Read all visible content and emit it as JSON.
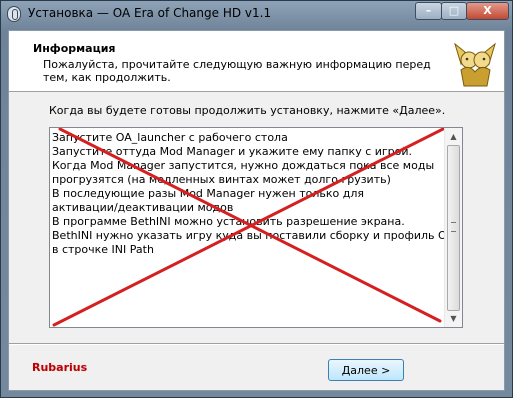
{
  "window": {
    "title": "Установка — OA Era of Change HD v1.1",
    "minimize_glyph": "–",
    "maximize_glyph": "□",
    "close_glyph": "X"
  },
  "header": {
    "title": "Информация",
    "subtitle": "Пожалуйста, прочитайте следующую важную информацию перед тем, как продолжить."
  },
  "main": {
    "instruction": "Когда вы будете готовы продолжить установку, нажмите «Далее».",
    "info_lines": [
      "Запустите OA_launcher с рабочего стола",
      "Запустите оттуда Mod Manager и укажите ему папку с игрой.",
      "Когда Mod Manager запустится, нужно дождаться пока все моды",
      "прогрузятся (на медленных винтах может долго грузить)",
      "В последующие разы Mod Manager нужен только для",
      "активации/деактивации модов",
      "В программе BethINI можно установить разрешение экрана.",
      "BethINI нужно указать игру куда вы поставили сборку и профиль OA_Default",
      "в строчке INI Path"
    ],
    "scroll_up_glyph": "▲",
    "scroll_down_glyph": "▼",
    "annotation_color": "#d42020"
  },
  "footer": {
    "brand": "Rubarius",
    "next_label": "Далее >"
  },
  "colors": {
    "brand": "#c00000",
    "button_border": "#3c7fb1",
    "close_button": "#c24a34"
  }
}
